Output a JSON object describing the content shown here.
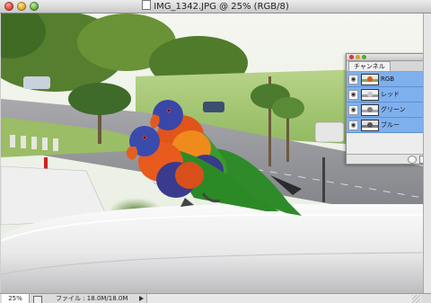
{
  "window": {
    "title": "IMG_1342.JPG @ 25% (RGB/8)"
  },
  "status": {
    "zoom": "25%",
    "file_info": "ファイル : 18.0M/18.0M"
  },
  "panel": {
    "tab": "チャンネル",
    "menu_glyph": "≡",
    "channels": [
      {
        "label": "RGB",
        "tint": "#4d7a3a"
      },
      {
        "label": "レッド",
        "tint": "#a5a5a5"
      },
      {
        "label": "グリーン",
        "tint": "#8c8c8c"
      },
      {
        "label": "ブルー",
        "tint": "#6f6f6f"
      }
    ]
  },
  "icons": {
    "eye": "◉"
  }
}
